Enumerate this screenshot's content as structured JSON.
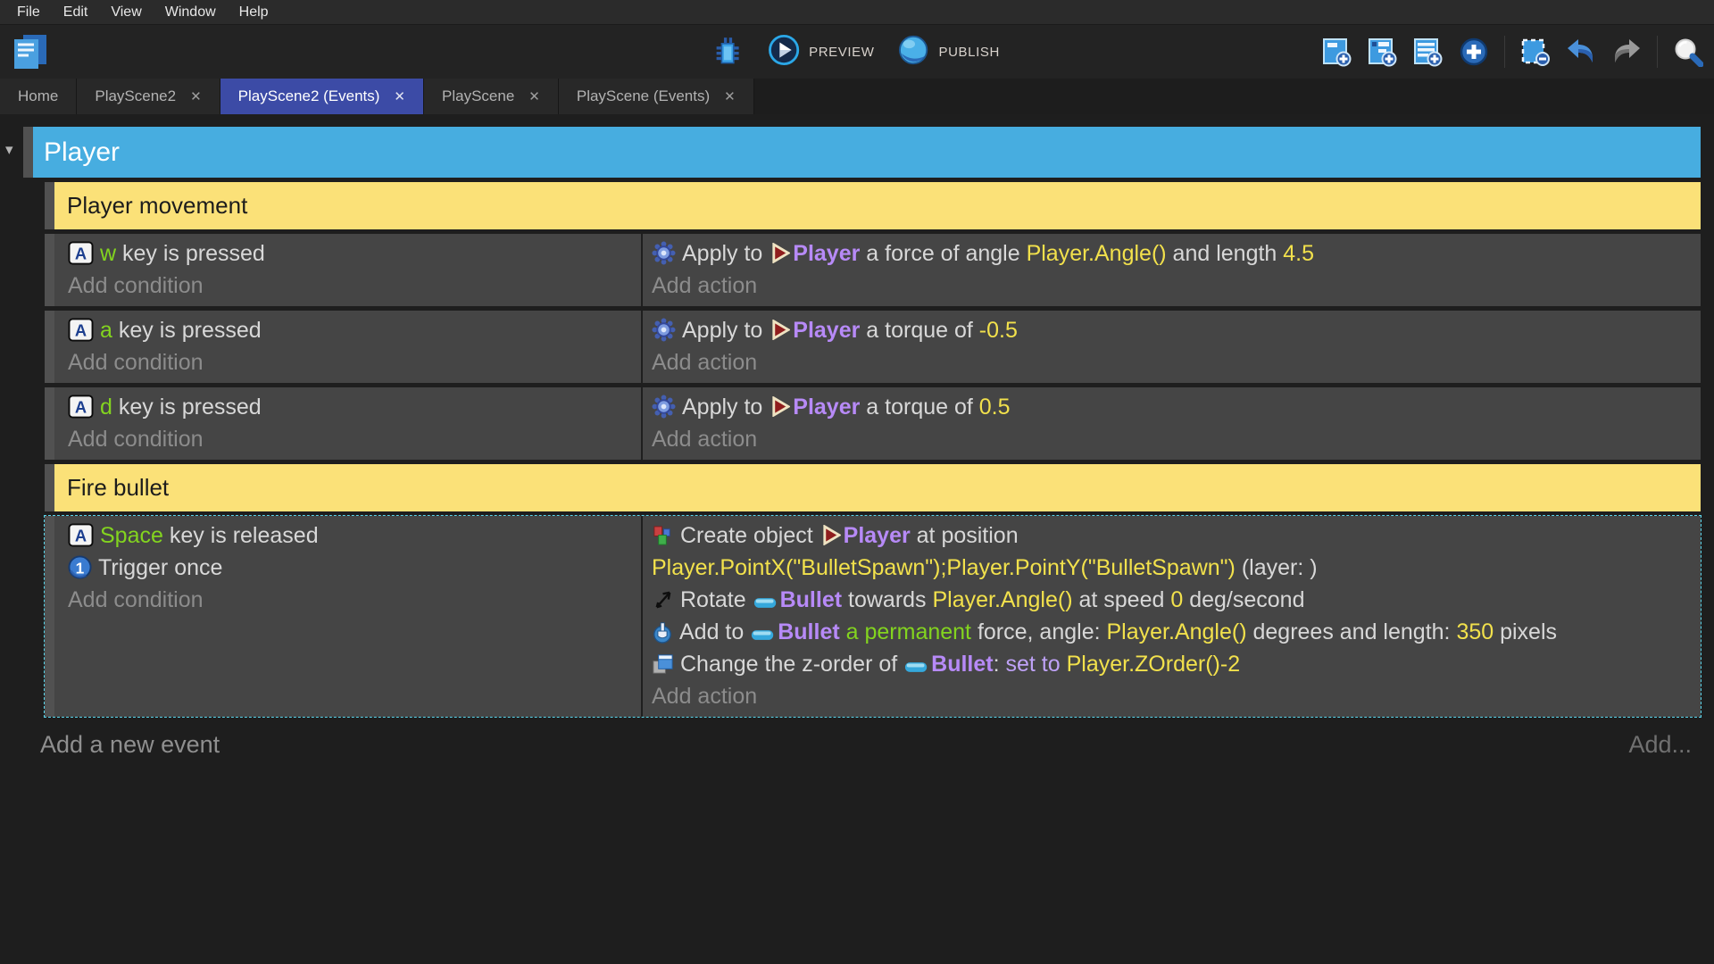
{
  "menu": {
    "items": [
      "File",
      "Edit",
      "View",
      "Window",
      "Help"
    ]
  },
  "toolbar": {
    "project_icon": "project-manager-icon",
    "debug_icon": "debug-icon",
    "preview": {
      "icon": "preview-play-icon",
      "label": "PREVIEW"
    },
    "publish": {
      "icon": "publish-globe-icon",
      "label": "PUBLISH"
    },
    "right_icons": [
      "add-event-icon",
      "add-subevent-icon",
      "add-comment-event-icon",
      "add-circle-icon",
      "separator",
      "delete-selection-icon",
      "undo-icon",
      "redo-icon",
      "separator",
      "search-icon"
    ]
  },
  "tabs": [
    {
      "label": "Home",
      "closable": false,
      "active": false
    },
    {
      "label": "PlayScene2",
      "closable": true,
      "active": false
    },
    {
      "label": "PlayScene2 (Events)",
      "closable": true,
      "active": true
    },
    {
      "label": "PlayScene",
      "closable": true,
      "active": false
    },
    {
      "label": "PlayScene (Events)",
      "closable": true,
      "active": false
    }
  ],
  "events": {
    "group": {
      "title": "Player"
    },
    "add_condition_label": "Add condition",
    "add_action_label": "Add action",
    "items": [
      {
        "type": "comment",
        "text": "Player movement"
      },
      {
        "type": "event",
        "selected": false,
        "conditions": [
          {
            "icon": "keyboard-icon",
            "segments": [
              [
                "w ",
                "green"
              ],
              [
                "key is pressed",
                "plain"
              ]
            ]
          }
        ],
        "actions": [
          {
            "icon": "force-icon",
            "segments": [
              [
                "Apply to ",
                "plain"
              ],
              [
                "player-object-icon",
                "icon"
              ],
              [
                "Player",
                "object"
              ],
              [
                " a force of angle ",
                "plain"
              ],
              [
                "Player.Angle()",
                "expr"
              ],
              [
                " and length ",
                "plain"
              ],
              [
                "4.5",
                "expr"
              ]
            ]
          }
        ]
      },
      {
        "type": "event",
        "selected": false,
        "conditions": [
          {
            "icon": "keyboard-icon",
            "segments": [
              [
                "a ",
                "green"
              ],
              [
                "key is pressed",
                "plain"
              ]
            ]
          }
        ],
        "actions": [
          {
            "icon": "force-icon",
            "segments": [
              [
                "Apply to ",
                "plain"
              ],
              [
                "player-object-icon",
                "icon"
              ],
              [
                "Player",
                "object"
              ],
              [
                " a torque of ",
                "plain"
              ],
              [
                "-0.5",
                "expr"
              ]
            ]
          }
        ]
      },
      {
        "type": "event",
        "selected": false,
        "conditions": [
          {
            "icon": "keyboard-icon",
            "segments": [
              [
                "d ",
                "green"
              ],
              [
                "key is pressed",
                "plain"
              ]
            ]
          }
        ],
        "actions": [
          {
            "icon": "force-icon",
            "segments": [
              [
                "Apply to ",
                "plain"
              ],
              [
                "player-object-icon",
                "icon"
              ],
              [
                "Player",
                "object"
              ],
              [
                " a torque of ",
                "plain"
              ],
              [
                "0.5",
                "expr"
              ]
            ]
          }
        ]
      },
      {
        "type": "comment",
        "text": "Fire bullet"
      },
      {
        "type": "event",
        "selected": true,
        "conditions": [
          {
            "icon": "keyboard-icon",
            "segments": [
              [
                "Space ",
                "green"
              ],
              [
                "key is released",
                "plain"
              ]
            ]
          },
          {
            "icon": "trigger-once-icon",
            "segments": [
              [
                "Trigger once",
                "plain"
              ]
            ]
          }
        ],
        "actions": [
          {
            "icon": "create-object-icon",
            "segments": [
              [
                "Create object ",
                "plain"
              ],
              [
                "player-object-icon",
                "icon"
              ],
              [
                "Player",
                "object"
              ],
              [
                " at position ",
                "plain"
              ],
              [
                "",
                "br"
              ],
              [
                "Player.PointX(\"BulletSpawn\");Player.PointY(\"BulletSpawn\")",
                "expr"
              ],
              [
                " (layer: )",
                "plain"
              ]
            ]
          },
          {
            "icon": "rotate-icon",
            "segments": [
              [
                "Rotate ",
                "plain"
              ],
              [
                "bullet-object-icon",
                "icon"
              ],
              [
                "Bullet",
                "object"
              ],
              [
                " towards ",
                "plain"
              ],
              [
                "Player.Angle()",
                "expr"
              ],
              [
                " at speed ",
                "plain"
              ],
              [
                "0",
                "expr"
              ],
              [
                " deg/second",
                "plain"
              ]
            ]
          },
          {
            "icon": "hand-force-icon",
            "segments": [
              [
                "Add to ",
                "plain"
              ],
              [
                "bullet-object-icon",
                "icon"
              ],
              [
                "Bullet",
                "object"
              ],
              [
                " a permanent",
                "green"
              ],
              [
                " force, angle: ",
                "plain"
              ],
              [
                "Player.Angle()",
                "expr"
              ],
              [
                " degrees and length: ",
                "plain"
              ],
              [
                "350",
                "expr"
              ],
              [
                " pixels",
                "plain"
              ]
            ]
          },
          {
            "icon": "zorder-icon",
            "segments": [
              [
                "Change the z-order of ",
                "plain"
              ],
              [
                "bullet-object-icon",
                "icon"
              ],
              [
                "Bullet",
                "object"
              ],
              [
                ": ",
                "plain"
              ],
              [
                "set to ",
                "setto"
              ],
              [
                "Player.ZOrder()-2",
                "expr"
              ]
            ]
          }
        ]
      }
    ]
  },
  "footer": {
    "add_new_event": "Add a new event",
    "add_more": "Add..."
  },
  "colors": {
    "group_header": "#47ade0",
    "comment_bg": "#fbe178",
    "active_tab": "#3c4ba6",
    "selection_border": "#59d6ec",
    "expression": "#f2e14c",
    "object_name": "#b78af7",
    "key_highlight": "#83d41f"
  }
}
